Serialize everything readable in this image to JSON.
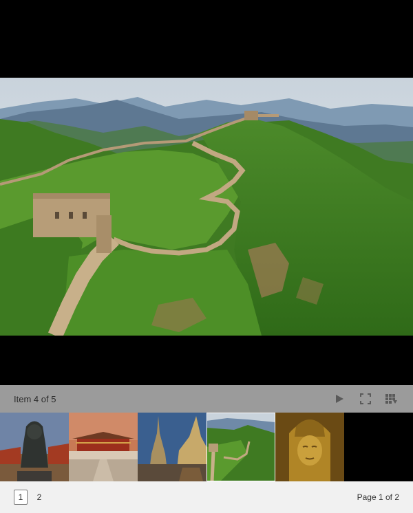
{
  "gallery": {
    "counter": "Item 4 of 5",
    "current_item": 4,
    "total_items": 5
  },
  "main_image": {
    "subject": "great-wall-landscape"
  },
  "toolbar": {
    "icons": [
      "play-icon",
      "fullscreen-icon",
      "thumbnails-toggle-icon"
    ],
    "icon_color": "#5a5a5a"
  },
  "thumbnails": [
    {
      "subject": "guardian-lion-statue"
    },
    {
      "subject": "forbidden-city-hall"
    },
    {
      "subject": "golden-stupa-temple"
    },
    {
      "subject": "great-wall-landscape",
      "active": true
    },
    {
      "subject": "golden-buddha-face"
    }
  ],
  "pagination": {
    "pages": [
      "1",
      "2"
    ],
    "current_page": "1",
    "page_info": "Page 1 of 2"
  }
}
